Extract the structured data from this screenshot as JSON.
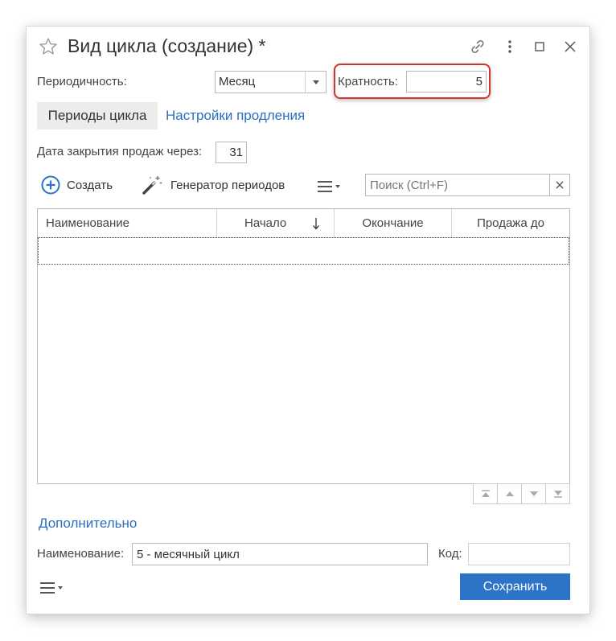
{
  "window": {
    "title": "Вид цикла (создание) *"
  },
  "form": {
    "periodicity_label": "Периодичность:",
    "periodicity_value": "Месяц",
    "multiplicity_label": "Кратность:",
    "multiplicity_value": "5"
  },
  "tabs": [
    {
      "label": "Периоды цикла",
      "active": true
    },
    {
      "label": "Настройки продления",
      "active": false
    }
  ],
  "sales_close": {
    "label": "Дата закрытия продаж через:",
    "value": "31"
  },
  "toolbar": {
    "create_label": "Создать",
    "generator_label": "Генератор периодов",
    "search_placeholder": "Поиск (Ctrl+F)"
  },
  "table": {
    "columns": [
      "Наименование",
      "Начало",
      "Окончание",
      "Продажа до"
    ],
    "rows": []
  },
  "additional": {
    "section_label": "Дополнительно",
    "name_label": "Наименование:",
    "name_value": "5 - месячный цикл",
    "code_label": "Код:",
    "code_value": ""
  },
  "footer": {
    "save_label": "Сохранить"
  },
  "colors": {
    "accent": "#2b74c7",
    "link": "#2c6fbf",
    "highlight": "#d0342c"
  }
}
